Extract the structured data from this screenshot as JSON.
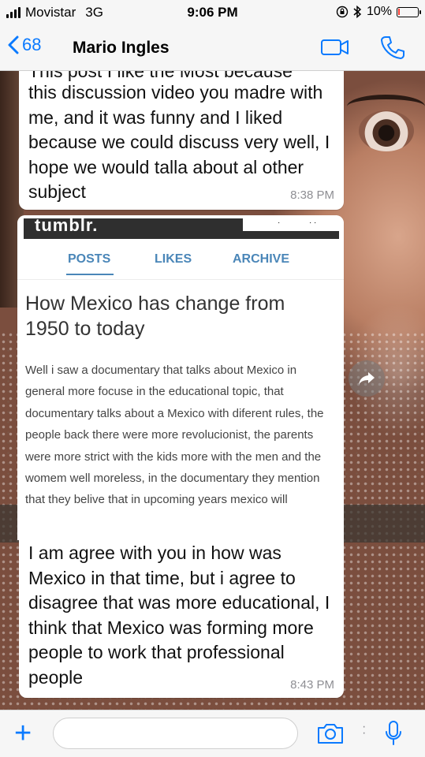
{
  "status_bar": {
    "carrier": "Movistar",
    "network": "3G",
    "time": "9:06 PM",
    "battery": "10%",
    "icons": [
      "signal-icon",
      "lock-rotation-icon",
      "bluetooth-icon",
      "battery-icon"
    ],
    "battery_level": 0.1,
    "battery_color": "#ff3b30"
  },
  "header": {
    "back_count": "68",
    "contact_name": "Mario Ingles",
    "accent": "#0a7aff"
  },
  "messages": [
    {
      "cut_line": "This post I like the Most because",
      "text": "this discussion video you madre with me, and it was funny and I liked because we could discuss very well, I hope we would talla about al other subject",
      "time": "8:38 PM"
    },
    {
      "image": {
        "blog_logo": "tumblr.",
        "tabs": [
          "POSTS",
          "LIKES",
          "ARCHIVE"
        ],
        "active_tab": "POSTS",
        "title": "How Mexico has change from 1950 to today",
        "body": "Well i saw a documentary that talks about Mexico in general more focuse in the educational topic, that documentary talks about a Mexico with diferent rules, the people back there were more revolucionist, the parents were more strict with the kids more with the men and the womem well moreless, in the documentary they mention that they belive that in upcoming years mexico will"
      }
    },
    {
      "text": "I am agree with you in how was Mexico in that time, but i agree to disagree that was more educational, I think that Mexico was forming more people to work that professional people",
      "time": "8:43 PM"
    }
  ],
  "input_bar": {
    "placeholder": ""
  }
}
